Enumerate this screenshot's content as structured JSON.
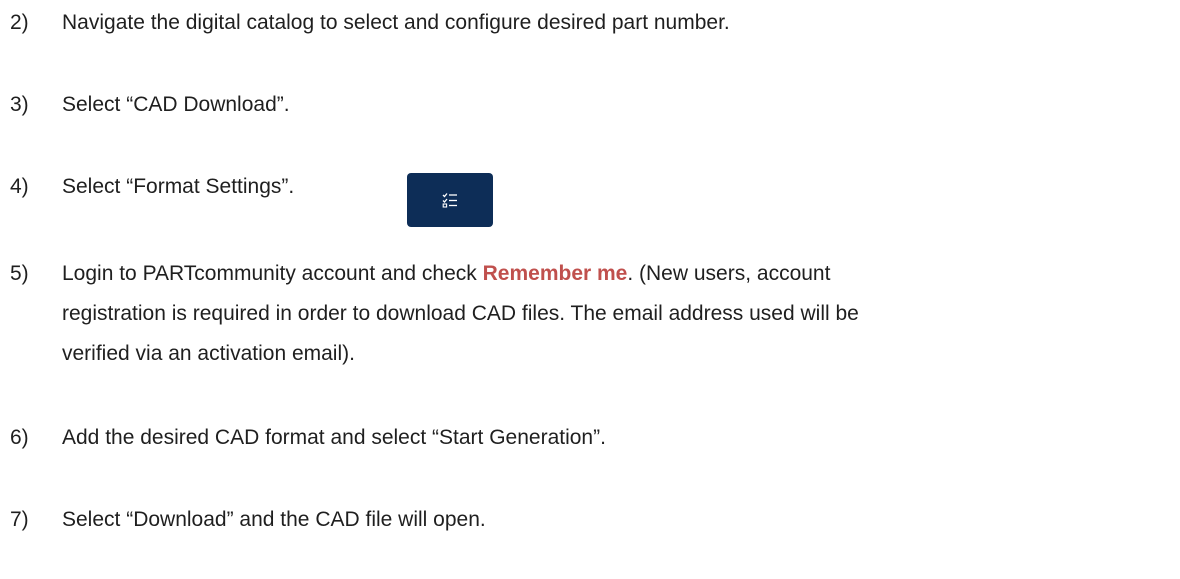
{
  "steps": [
    {
      "num": "2)",
      "text": "Navigate the digital catalog to select and configure desired part number."
    },
    {
      "num": "3)",
      "text": "Select “CAD Download”."
    },
    {
      "num": "4)",
      "text": "Select “Format Settings”."
    },
    {
      "num": "5)",
      "line1_before": "Login to PARTcommunity account and check ",
      "line1_highlight": "Remember me",
      "line1_after": ". (New users, account",
      "line2": "registration is required in order to download CAD files. The email address used will be",
      "line3": "verified via an activation email)."
    },
    {
      "num": "6)",
      "text": "Add the desired CAD format and select “Start Generation”."
    },
    {
      "num": "7)",
      "text": "Select “Download” and the CAD file will open."
    }
  ],
  "format_button": {
    "icon": "checklist-icon",
    "background": "#0d2d57"
  },
  "colors": {
    "text": "#1f1f1f",
    "highlight": "#c0504d"
  }
}
